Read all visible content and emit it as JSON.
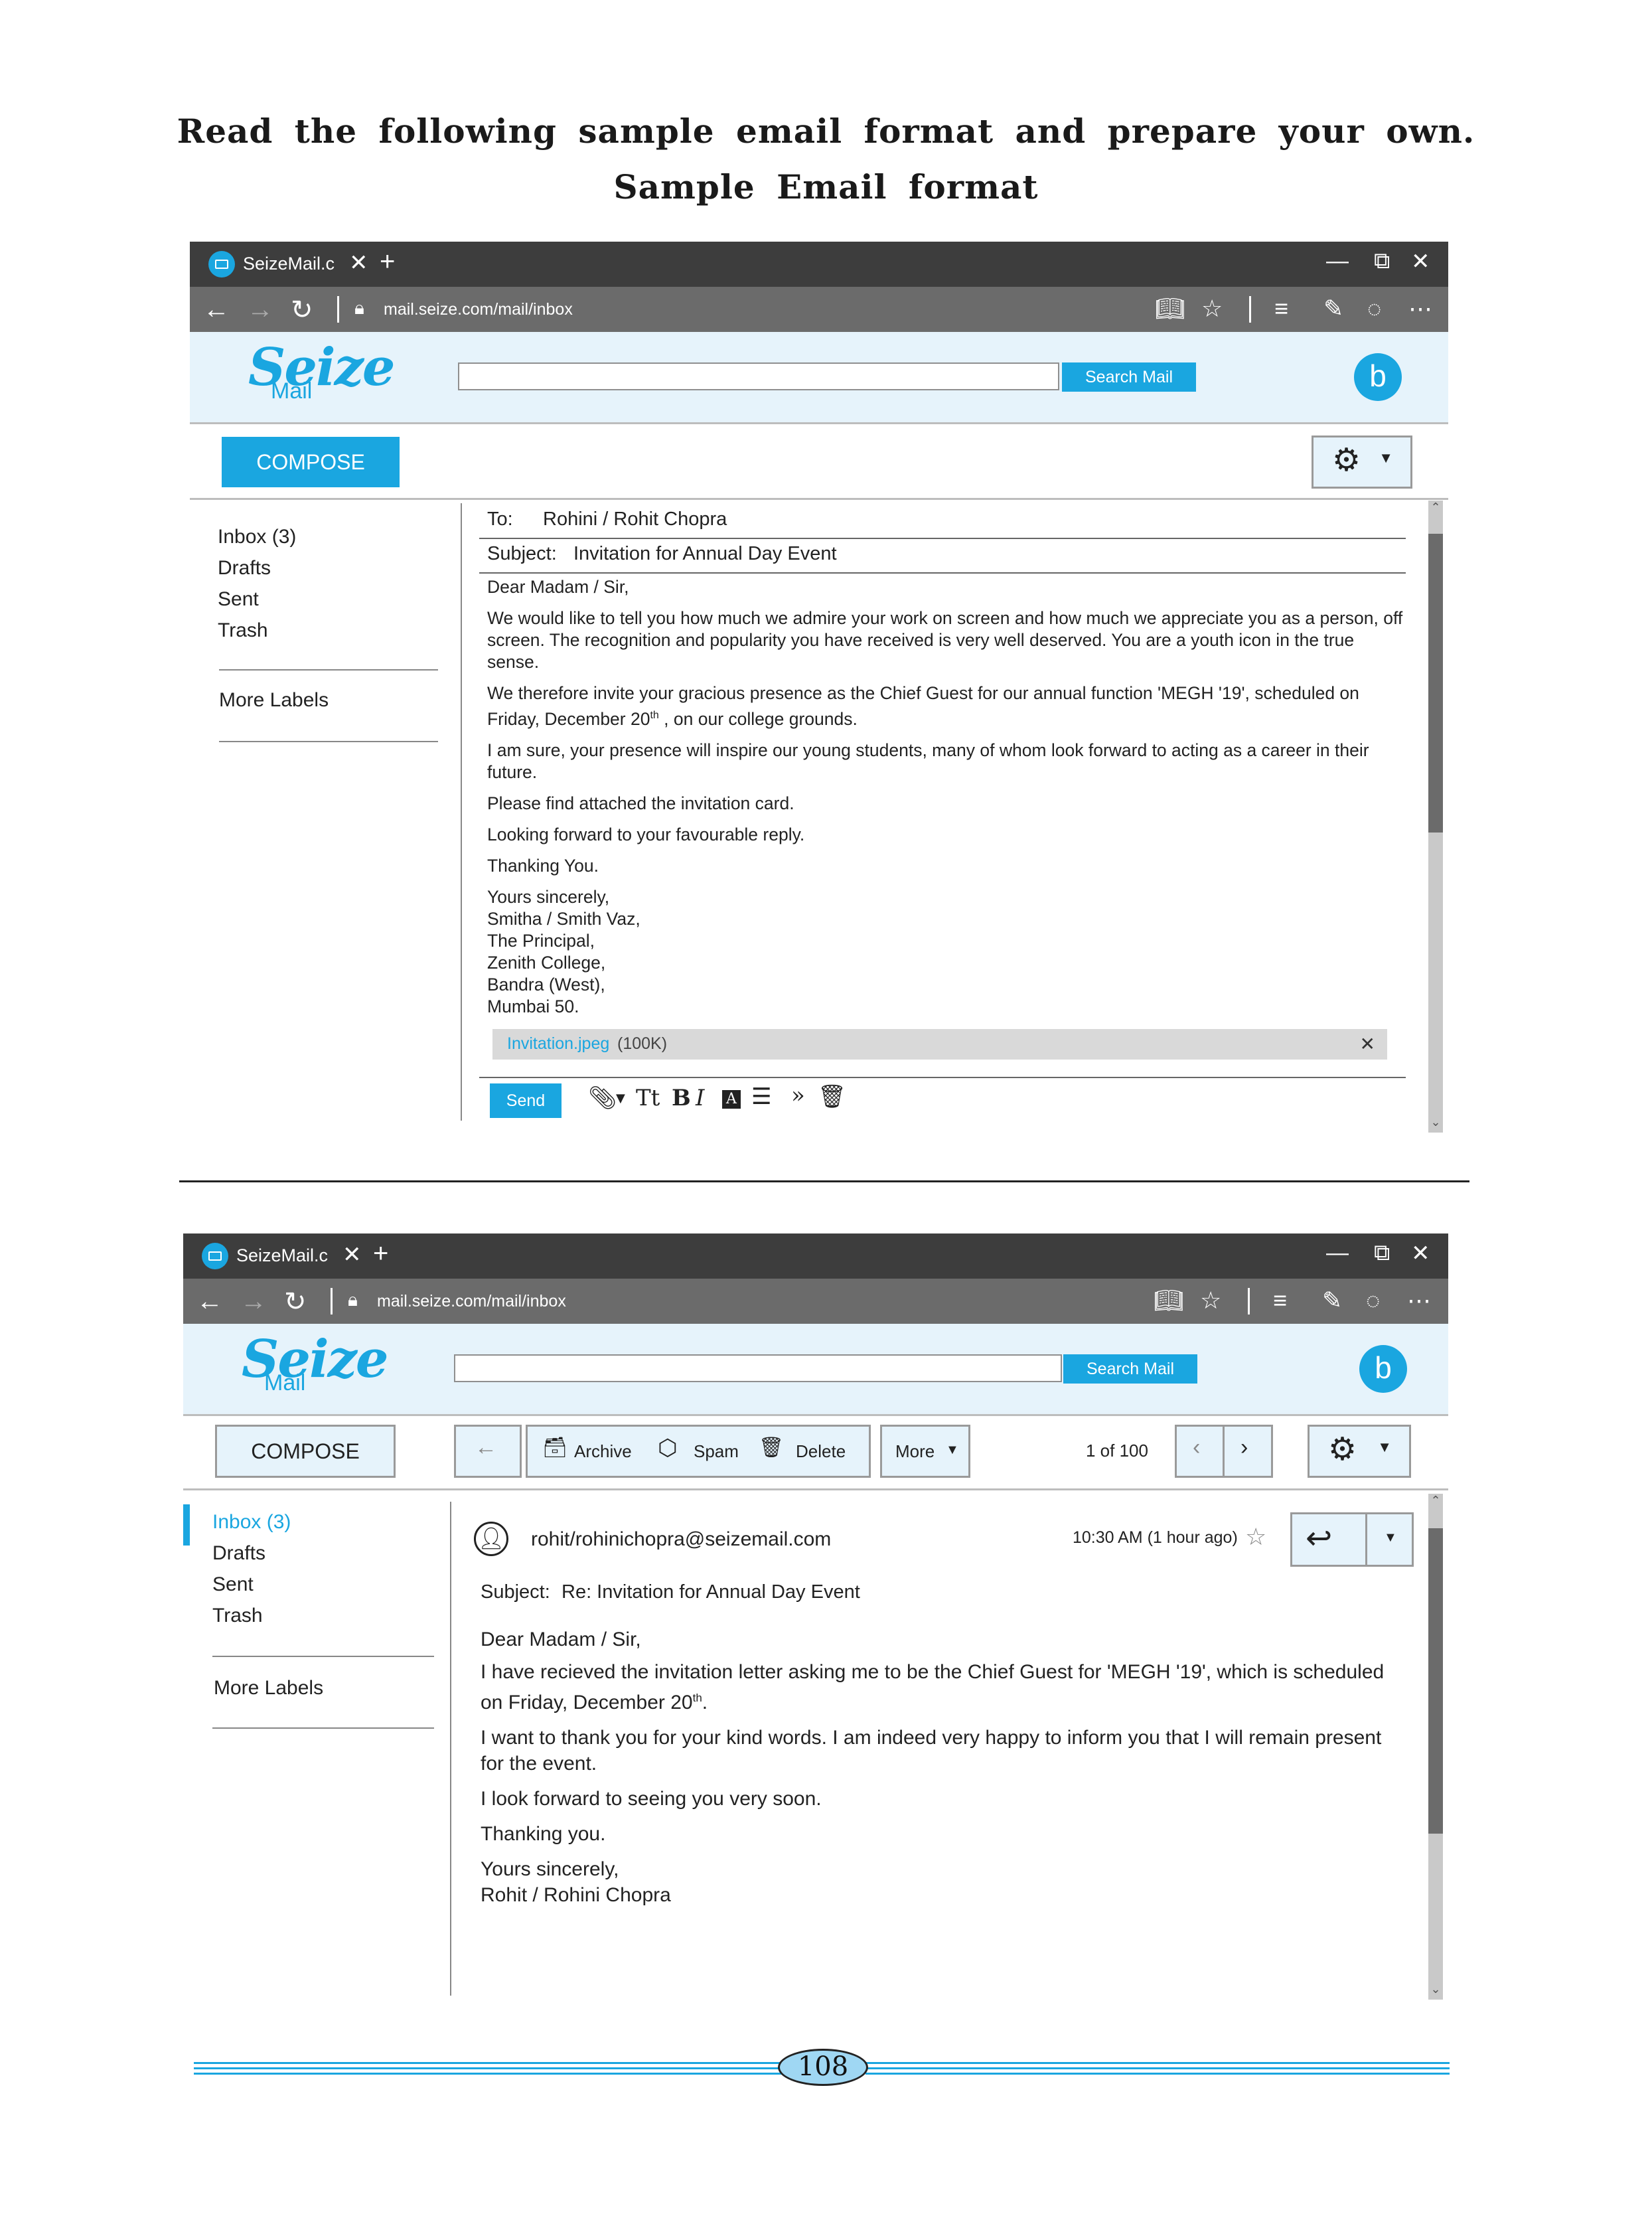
{
  "instruction": "Read the following sample email format and prepare your own.",
  "section_title": "Sample Email format",
  "browser": {
    "tab_title": "SeizeMail.c",
    "new_tab": "+",
    "minimize": "—",
    "restore": "⧉",
    "close": "✕",
    "url": "mail.seize.com/mail/inbox"
  },
  "app": {
    "logo_top": "Seize",
    "logo_bottom": "Mail",
    "search_button": "Search Mail",
    "avatar_letter": "b",
    "compose": "COMPOSE"
  },
  "sidebar": {
    "items": [
      "Inbox (3)",
      "Drafts",
      "Sent",
      "Trash"
    ],
    "more_labels": "More Labels"
  },
  "compose_view": {
    "to_label": "To:",
    "to_value": "Rohini / Rohit Chopra",
    "subject_label": "Subject:",
    "subject_value": "Invitation for Annual Day Event",
    "greeting": "Dear Madam / Sir,",
    "p1": "We would like to tell you how much we admire your work on screen and how much we appreciate you as a person, off screen. The recognition and popularity you have received is very well deserved. You are a youth icon in the true sense.",
    "p2_a": "We therefore invite your gracious presence as the Chief Guest for our annual function 'MEGH '19', scheduled on Friday, December 20",
    "p2_sup": "th",
    "p2_b": " , on our college grounds.",
    "p3": "I am sure, your presence  will inspire our young students, many of whom look forward to acting as a career in their future.",
    "p4": "Please find attached the invitation card.",
    "p5": "Looking forward to your favourable reply.",
    "p6": "Thanking You.",
    "signature": [
      "Yours sincerely,",
      "Smitha / Smith Vaz,",
      "The Principal,",
      "Zenith College,",
      "Bandra (West),",
      "Mumbai 50."
    ],
    "attachment_name": "Invitation.jpeg",
    "attachment_size": "(100K)",
    "send": "Send"
  },
  "read_view": {
    "toolbar": {
      "archive": "Archive",
      "spam": "Spam",
      "delete": "Delete",
      "more": "More",
      "pagination": "1 of 100"
    },
    "sender": "rohit/rohinichopra@seizemail.com",
    "time": "10:30 AM (1 hour ago)",
    "subject_label": "Subject:",
    "subject_value": "Re:  Invitation for Annual Day Event",
    "greeting": "Dear Madam / Sir,",
    "p1_a": "I have recieved the invitation letter asking me to be the Chief Guest for 'MEGH '19', which is scheduled on Friday, December  20",
    "p1_sup": "th",
    "p1_b": ".",
    "p2": "I want to thank you for your kind words. I am indeed very happy to inform you that I will remain present for the event.",
    "p3": "I look forward to seeing you very soon.",
    "p4": "Thanking you.",
    "signature": [
      "Yours sincerely,",
      "Rohit / Rohini Chopra"
    ]
  },
  "page_number": "108",
  "colors": {
    "accent": "#1aa6e0",
    "app_bg": "#e6f3fb",
    "titlebar": "#3d3d3d",
    "addressbar": "#6b6b6b"
  }
}
